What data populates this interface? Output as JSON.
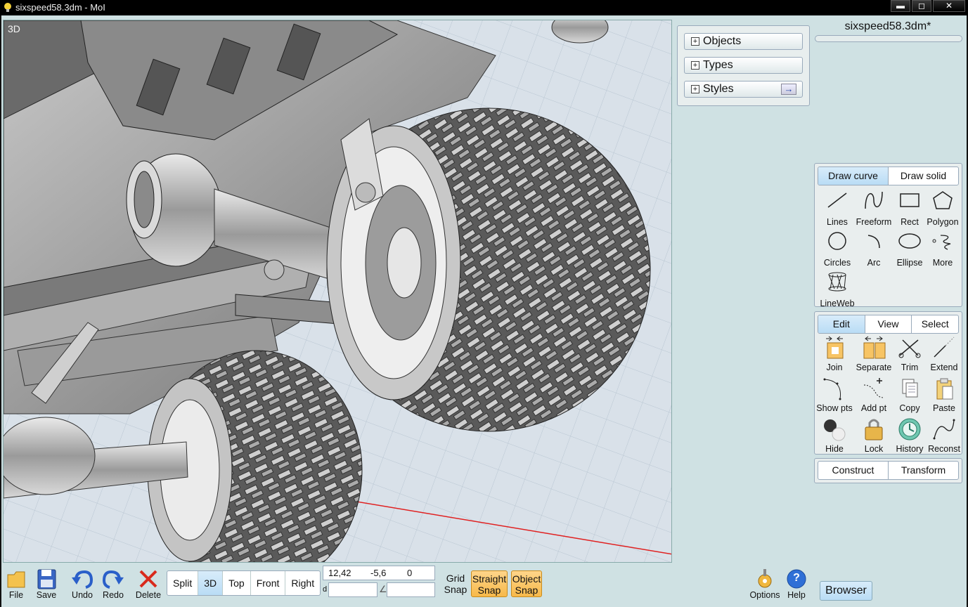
{
  "window": {
    "title": "sixspeed58.3dm - MoI",
    "minimize": "▬",
    "maximize": "◻",
    "close": "✕"
  },
  "viewport": {
    "label": "3D"
  },
  "scene_panel": {
    "objects": "Objects",
    "types": "Types",
    "styles": "Styles",
    "styles_arrow": "→"
  },
  "file": {
    "name": "sixspeed58.3dm*"
  },
  "draw_palette": {
    "tabs": [
      "Draw curve",
      "Draw solid"
    ],
    "active_tab": "Draw curve",
    "tools": [
      "Lines",
      "Freeform",
      "Rect",
      "Polygon",
      "Circles",
      "Arc",
      "Ellipse",
      "More",
      "LineWeb"
    ]
  },
  "edit_palette": {
    "tabs": [
      "Edit",
      "View",
      "Select"
    ],
    "active_tab": "Edit",
    "tools": [
      "Join",
      "Separate",
      "Trim",
      "Extend",
      "Show pts",
      "Add pt",
      "Copy",
      "Paste",
      "Hide",
      "Lock",
      "History",
      "Reconst"
    ]
  },
  "construct_palette": {
    "tabs": [
      "Construct",
      "Transform"
    ]
  },
  "bottom": {
    "file": "File",
    "save": "Save",
    "undo": "Undo",
    "redo": "Redo",
    "delete": "Delete",
    "views": [
      "Split",
      "3D",
      "Top",
      "Front",
      "Right"
    ],
    "active_view": "3D",
    "coords": {
      "x": "12,42",
      "y": "-5,6",
      "z": "0",
      "d_label": "d",
      "d_value": "",
      "angle_label": "∠",
      "angle_value": ""
    },
    "grid_snap": [
      "Grid",
      "Snap"
    ],
    "straight_snap": [
      "Straight",
      "Snap"
    ],
    "object_snap": [
      "Object",
      "Snap"
    ],
    "options": "Options",
    "help": "Help",
    "help_glyph": "?",
    "browser": "Browser"
  },
  "colors": {
    "accent_tab": "#b9dcf5",
    "snap_on": "#f7b94a",
    "axis_red": "#e02020"
  }
}
